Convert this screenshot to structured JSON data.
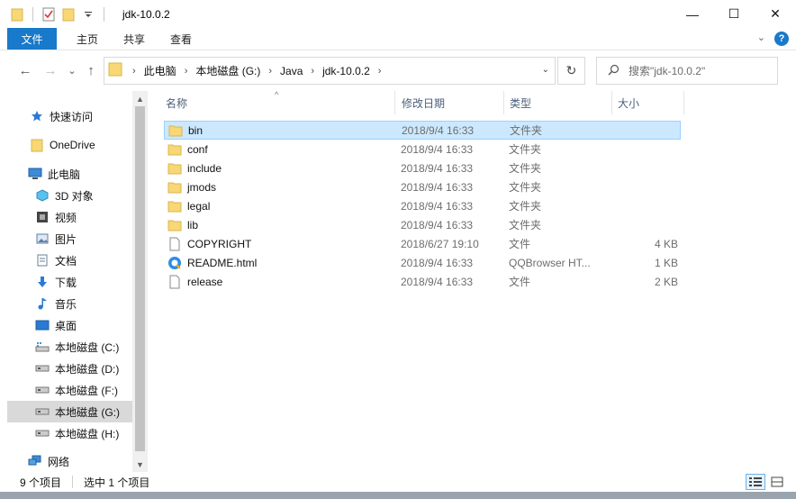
{
  "window": {
    "title": "jdk-10.0.2",
    "minimize_label": "—",
    "maximize_label": "☐",
    "close_label": "✕"
  },
  "ribbon": {
    "tabs": [
      {
        "label": "文件",
        "active": true
      },
      {
        "label": "主页"
      },
      {
        "label": "共享"
      },
      {
        "label": "查看"
      }
    ],
    "expand_label": "⌄",
    "help_label": "?"
  },
  "nav": {
    "back": "←",
    "forward": "→",
    "recent": "⌄",
    "up": "↑",
    "breadcrumbs": [
      "此电脑",
      "本地磁盘 (G:)",
      "Java",
      "jdk-10.0.2"
    ],
    "refresh": "↻",
    "search_placeholder": "搜索\"jdk-10.0.2\""
  },
  "sidebar": {
    "items": [
      {
        "label": "快速访问",
        "icon": "star-icon"
      },
      {
        "label": "OneDrive",
        "icon": "onedrive-folder-icon"
      },
      {
        "label": "此电脑",
        "icon": "computer-icon"
      },
      {
        "label": "3D 对象",
        "icon": "cube-icon"
      },
      {
        "label": "视频",
        "icon": "video-icon"
      },
      {
        "label": "图片",
        "icon": "picture-icon"
      },
      {
        "label": "文档",
        "icon": "document-icon"
      },
      {
        "label": "下载",
        "icon": "download-icon"
      },
      {
        "label": "音乐",
        "icon": "music-icon"
      },
      {
        "label": "桌面",
        "icon": "desktop-icon"
      },
      {
        "label": "本地磁盘 (C:)",
        "icon": "system-drive-icon"
      },
      {
        "label": "本地磁盘 (D:)",
        "icon": "drive-icon"
      },
      {
        "label": "本地磁盘 (F:)",
        "icon": "drive-icon"
      },
      {
        "label": "本地磁盘 (G:)",
        "icon": "drive-icon",
        "selected": true
      },
      {
        "label": "本地磁盘 (H:)",
        "icon": "drive-icon"
      },
      {
        "label": "网络",
        "icon": "network-icon"
      }
    ]
  },
  "columns": {
    "name": "名称",
    "date": "修改日期",
    "type": "类型",
    "size": "大小"
  },
  "files": [
    {
      "name": "bin",
      "date": "2018/9/4 16:33",
      "type": "文件夹",
      "size": "",
      "icon": "folder-icon",
      "selected": true
    },
    {
      "name": "conf",
      "date": "2018/9/4 16:33",
      "type": "文件夹",
      "size": "",
      "icon": "folder-icon"
    },
    {
      "name": "include",
      "date": "2018/9/4 16:33",
      "type": "文件夹",
      "size": "",
      "icon": "folder-icon"
    },
    {
      "name": "jmods",
      "date": "2018/9/4 16:33",
      "type": "文件夹",
      "size": "",
      "icon": "folder-icon"
    },
    {
      "name": "legal",
      "date": "2018/9/4 16:33",
      "type": "文件夹",
      "size": "",
      "icon": "folder-icon"
    },
    {
      "name": "lib",
      "date": "2018/9/4 16:33",
      "type": "文件夹",
      "size": "",
      "icon": "folder-icon"
    },
    {
      "name": "COPYRIGHT",
      "date": "2018/6/27 19:10",
      "type": "文件",
      "size": "4 KB",
      "icon": "file-icon"
    },
    {
      "name": "README.html",
      "date": "2018/9/4 16:33",
      "type": "QQBrowser HT...",
      "size": "1 KB",
      "icon": "browser-file-icon"
    },
    {
      "name": "release",
      "date": "2018/9/4 16:33",
      "type": "文件",
      "size": "2 KB",
      "icon": "file-icon"
    }
  ],
  "status": {
    "item_count": "9 个项目",
    "selected_count": "选中 1 个项目"
  },
  "colors": {
    "accent": "#1979ca",
    "selection_bg": "#cce8ff",
    "selection_border": "#99d1ff",
    "folder": "#f8d775"
  }
}
